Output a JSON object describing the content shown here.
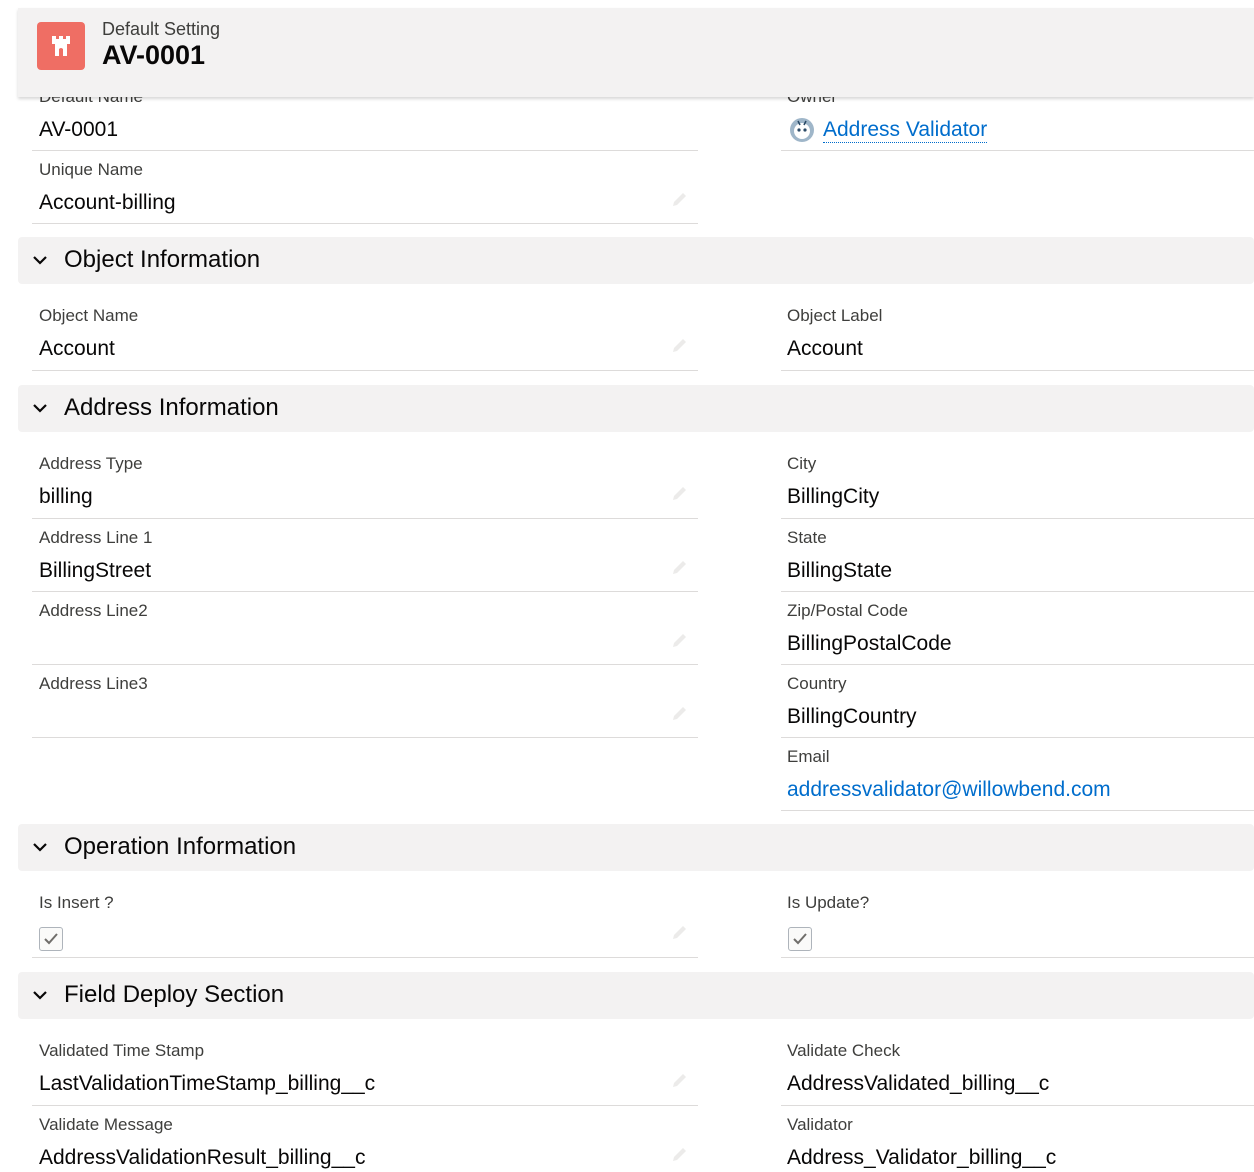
{
  "header": {
    "subtitle": "Default Setting",
    "title": "AV-0001",
    "icon": "castle-icon",
    "icon_color": "#ef6e64"
  },
  "top_fields": {
    "default_name": {
      "label": "Default Name",
      "value": "AV-0001"
    },
    "owner": {
      "label": "Owner",
      "value": "Address Validator",
      "icon": "user-avatar-icon"
    },
    "unique_name": {
      "label": "Unique Name",
      "value": "Account-billing"
    }
  },
  "sections": {
    "object": {
      "title": "Object Information",
      "object_name": {
        "label": "Object Name",
        "value": "Account"
      },
      "object_label": {
        "label": "Object Label",
        "value": "Account"
      }
    },
    "address": {
      "title": "Address Information",
      "address_type": {
        "label": "Address Type",
        "value": "billing"
      },
      "address_line1": {
        "label": "Address Line 1",
        "value": "BillingStreet"
      },
      "address_line2": {
        "label": "Address Line2",
        "value": ""
      },
      "address_line3": {
        "label": "Address Line3",
        "value": ""
      },
      "city": {
        "label": "City",
        "value": "BillingCity"
      },
      "state": {
        "label": "State",
        "value": "BillingState"
      },
      "zip": {
        "label": "Zip/Postal Code",
        "value": "BillingPostalCode"
      },
      "country": {
        "label": "Country",
        "value": "BillingCountry"
      },
      "email": {
        "label": "Email",
        "value": "addressvalidator@willowbend.com"
      }
    },
    "operation": {
      "title": "Operation Information",
      "is_insert": {
        "label": "Is Insert ?",
        "checked": true
      },
      "is_update": {
        "label": "Is Update?",
        "checked": true
      }
    },
    "deploy": {
      "title": "Field Deploy Section",
      "validated_time_stamp": {
        "label": "Validated Time Stamp",
        "value": "LastValidationTimeStamp_billing__c"
      },
      "validate_check": {
        "label": "Validate Check",
        "value": "AddressValidated_billing__c"
      },
      "validate_message": {
        "label": "Validate Message",
        "value": "AddressValidationResult_billing__c"
      },
      "validator": {
        "label": "Validator",
        "value": "Address_Validator_billing__c"
      }
    }
  },
  "colors": {
    "link": "#006dcc",
    "section_bg": "#f3f2f2",
    "divider": "#dddbda"
  }
}
